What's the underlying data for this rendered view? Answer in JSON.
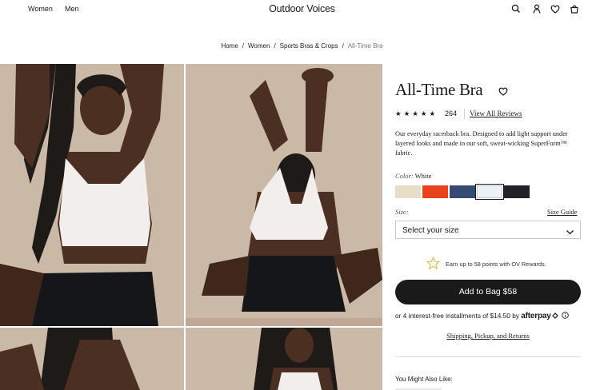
{
  "header": {
    "nav": [
      "Women",
      "Men"
    ],
    "brand": "Outdoor Voices",
    "icons": [
      "search-icon",
      "account-icon",
      "wishlist-icon",
      "bag-icon"
    ]
  },
  "breadcrumb": {
    "items": [
      "Home",
      "Women",
      "Sports Bras & Crops"
    ],
    "current": "All-Time Bra",
    "separator": "/"
  },
  "product": {
    "title": "All-Time Bra",
    "rating_stars": "★★★★★",
    "review_count": "264",
    "reviews_link": "View All Reviews",
    "description": "Our everyday racerback bra. Designed to add light support under layered looks and made in our soft, sweat-wicking SuperForm™ fabric.",
    "color_label": "Color:",
    "selected_color": "White",
    "swatches": [
      {
        "color": "#e6dfc6"
      },
      {
        "color": "#e8431c"
      },
      {
        "color": "#364a72"
      },
      {
        "color": "#eef0f6",
        "selected": true
      },
      {
        "color": "#1f2326"
      }
    ],
    "size_label": "Size:",
    "size_guide": "Size Guide",
    "size_select": "Select your size",
    "rewards_text": "Earn up to 58 points with OV Rewards.",
    "add_to_bag": "Add to Bag $58",
    "installments_text": "or 4 interest-free installments of $14.50 by",
    "afterpay": "afterpay",
    "shipping_link": "Shipping, Pickup, and Returns",
    "also_like": "You Might Also Like:"
  },
  "colors": {
    "text": "#1a1a1a",
    "button": "#1a1a1a",
    "photo_bg": "#cbb9a7",
    "rewards_star": "#d4b84a"
  }
}
